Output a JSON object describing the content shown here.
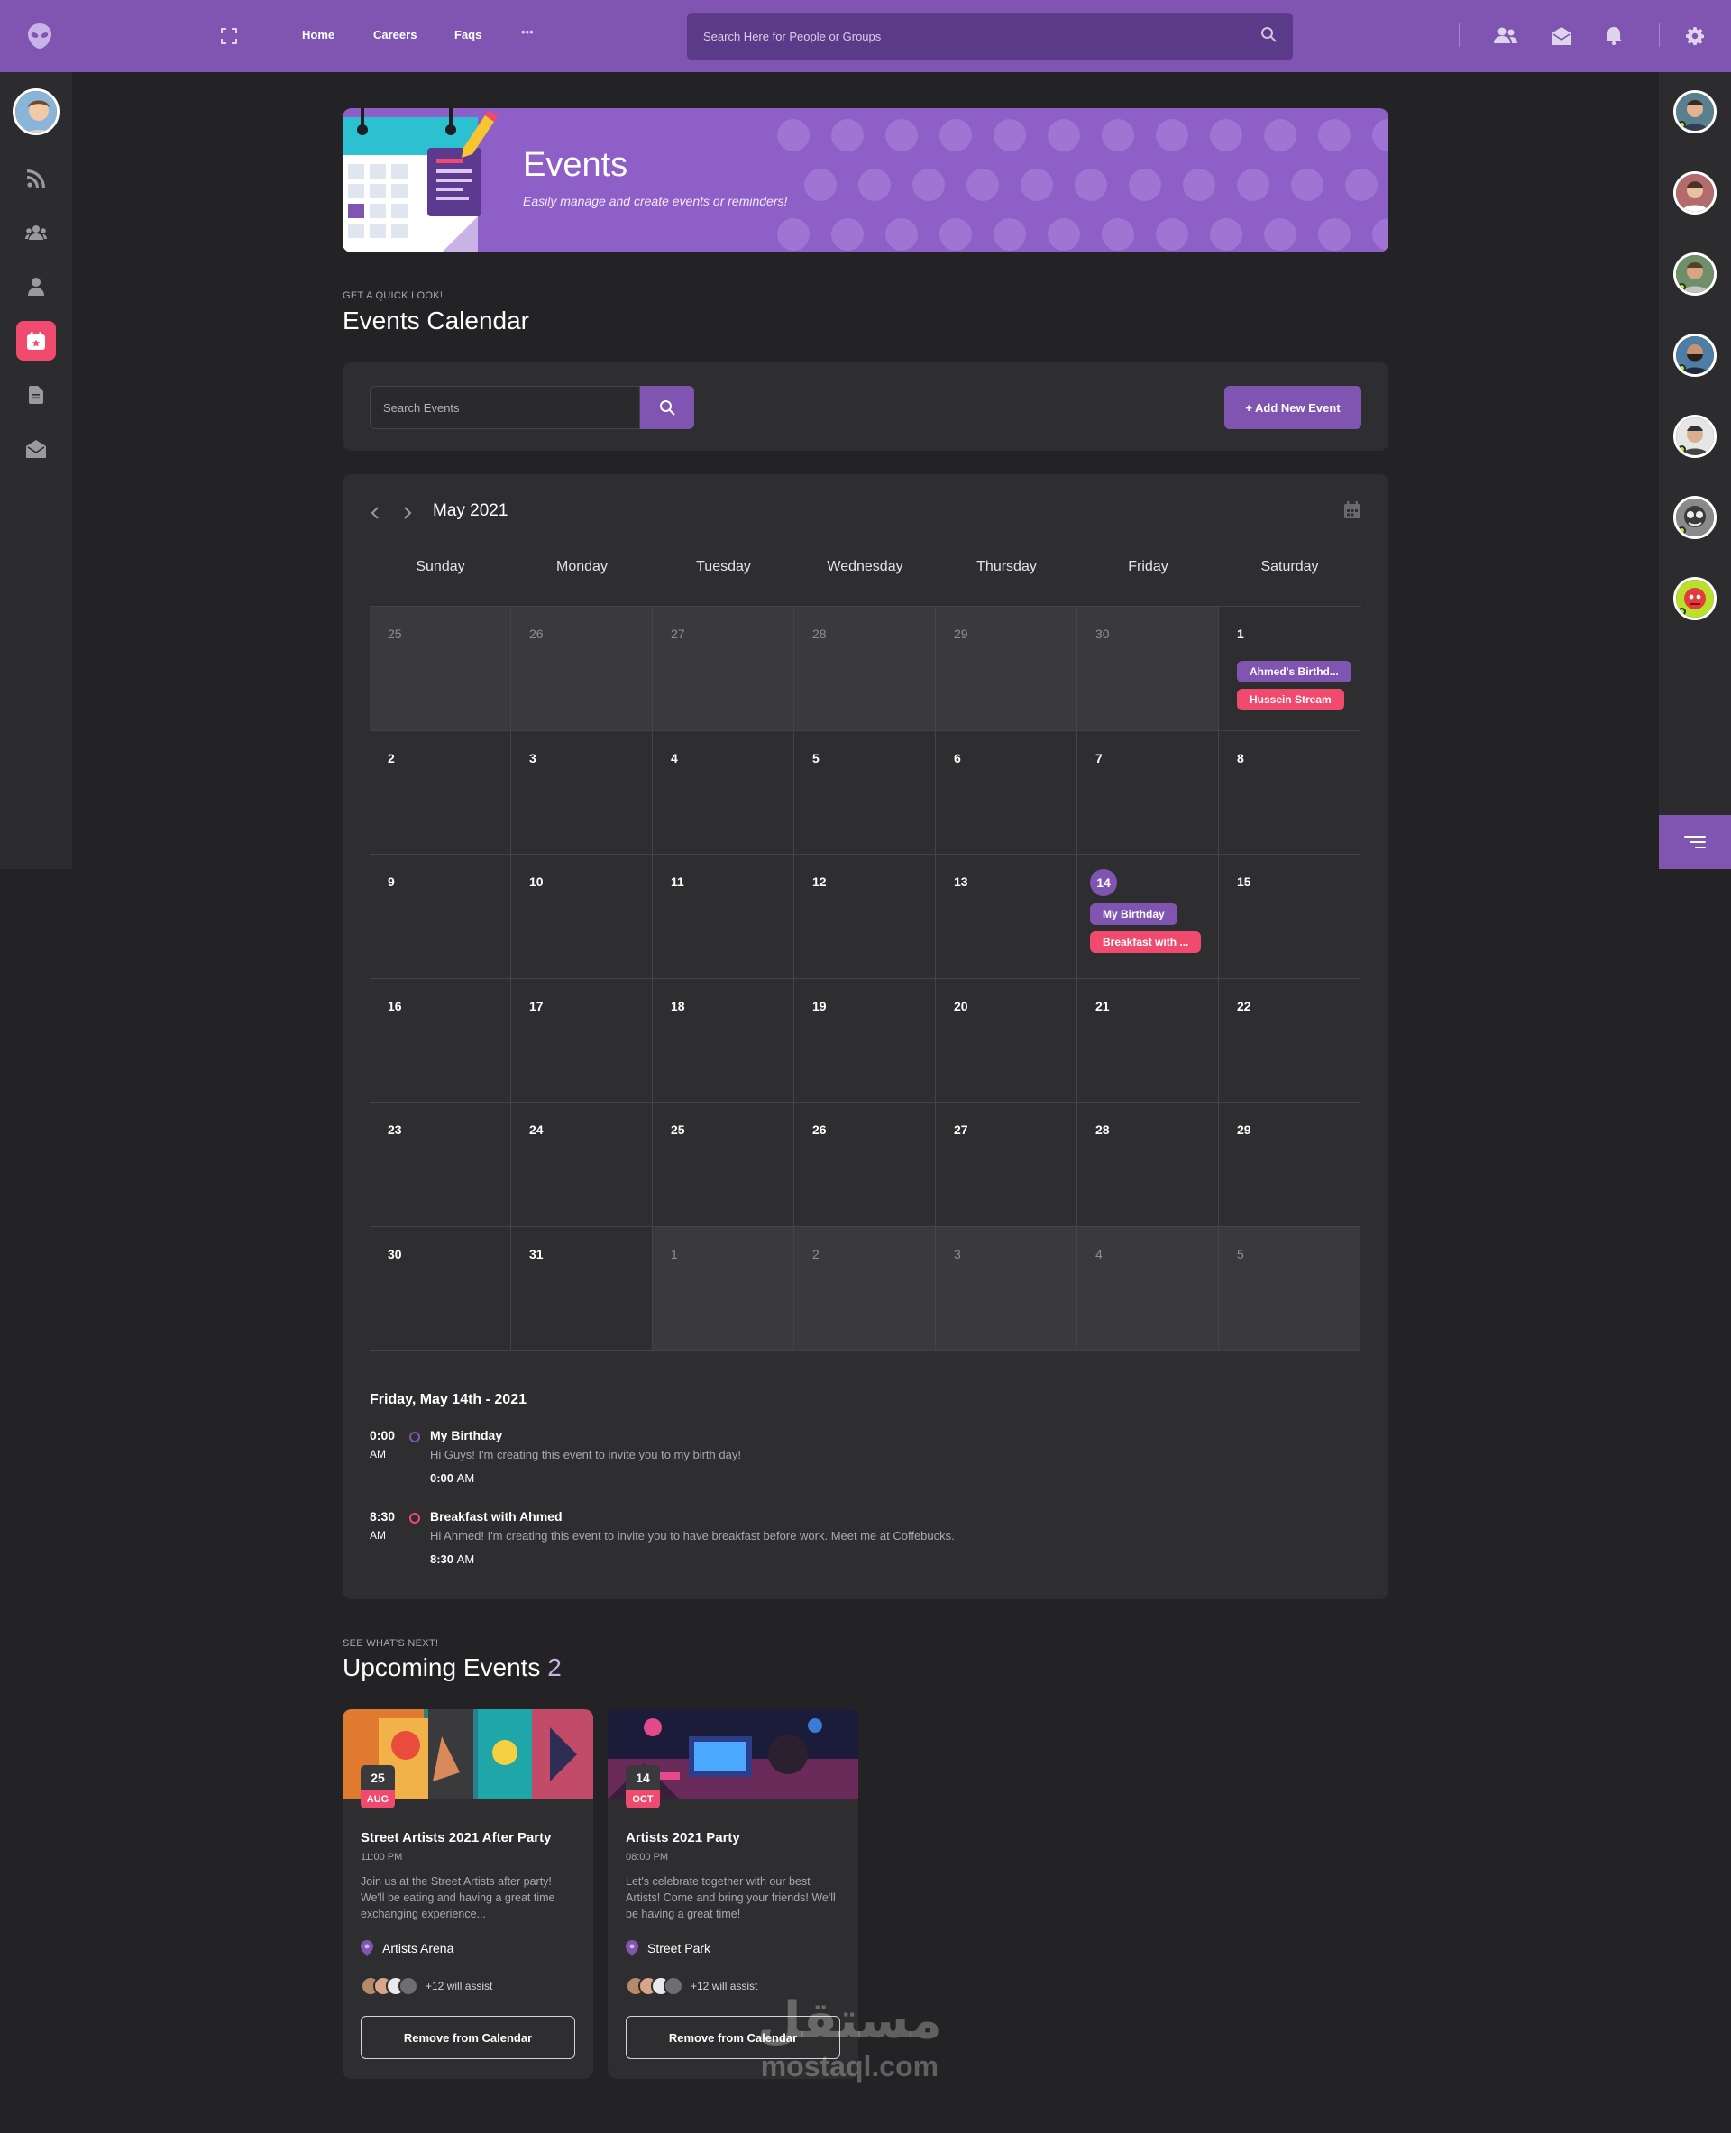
{
  "topbar": {
    "nav": [
      "Home",
      "Careers",
      "Faqs"
    ],
    "more": "•••",
    "search_placeholder": "Search Here for People or Groups"
  },
  "banner": {
    "title": "Events",
    "subtitle": "Easily manage and create events or reminders!"
  },
  "calendar_section": {
    "pretitle": "GET A QUICK LOOK!",
    "title": "Events Calendar",
    "search_placeholder": "Search Events",
    "add_button": "+ Add New Event"
  },
  "calendar": {
    "month": "May 2021",
    "days": [
      "Sunday",
      "Monday",
      "Tuesday",
      "Wednesday",
      "Thursday",
      "Friday",
      "Saturday"
    ],
    "weeks": [
      [
        "25",
        "26",
        "27",
        "28",
        "29",
        "30",
        "1"
      ],
      [
        "2",
        "3",
        "4",
        "5",
        "6",
        "7",
        "8"
      ],
      [
        "9",
        "10",
        "11",
        "12",
        "13",
        "14",
        "15"
      ],
      [
        "16",
        "17",
        "18",
        "19",
        "20",
        "21",
        "22"
      ],
      [
        "23",
        "24",
        "25",
        "26",
        "27",
        "28",
        "29"
      ],
      [
        "30",
        "31",
        "1",
        "2",
        "3",
        "4",
        "5"
      ]
    ],
    "chips": {
      "may1": [
        "Ahmed's Birthd...",
        "Hussein Stream"
      ],
      "may14": [
        "My Birthday",
        "Breakfast with ..."
      ]
    }
  },
  "day_detail": {
    "date": "Friday, May 14th - 2021",
    "events": [
      {
        "time": "0:00",
        "ampm": "AM",
        "title": "My Birthday",
        "desc": "Hi Guys! I'm creating this event to invite you to my birth day!",
        "when_time": "0:00",
        "when_ampm": "AM"
      },
      {
        "time": "8:30",
        "ampm": "AM",
        "title": "Breakfast with Ahmed",
        "desc": "Hi Ahmed! I'm creating this event to invite you to have breakfast before work. Meet me at Coffebucks.",
        "when_time": "8:30",
        "when_ampm": "AM"
      }
    ]
  },
  "upcoming": {
    "pretitle": "SEE WHAT'S NEXT!",
    "title": "Upcoming Events",
    "count": "2",
    "cards": [
      {
        "day": "25",
        "month": "AUG",
        "title": "Street Artists 2021 After Party",
        "time": "11:00 PM",
        "desc": "Join us at the Street Artists after party! We'll be eating and having a great time exchanging experience...",
        "location": "Artists Arena",
        "attendees": "+12 will assist",
        "button": "Remove from Calendar"
      },
      {
        "day": "14",
        "month": "OCT",
        "title": "Artists 2021 Party",
        "time": "08:00 PM",
        "desc": "Let's celebrate together with our best Artists! Come and bring your friends! We'll be having a great time!",
        "location": "Street Park",
        "attendees": "+12 will assist",
        "button": "Remove from Calendar"
      }
    ]
  },
  "watermark": {
    "arabic": "مستقل",
    "latin": "mostaql.com"
  },
  "colors": {
    "accent": "#7f55b1",
    "pink": "#f04b6e",
    "background": "#232325",
    "panel": "#2e2e30"
  }
}
